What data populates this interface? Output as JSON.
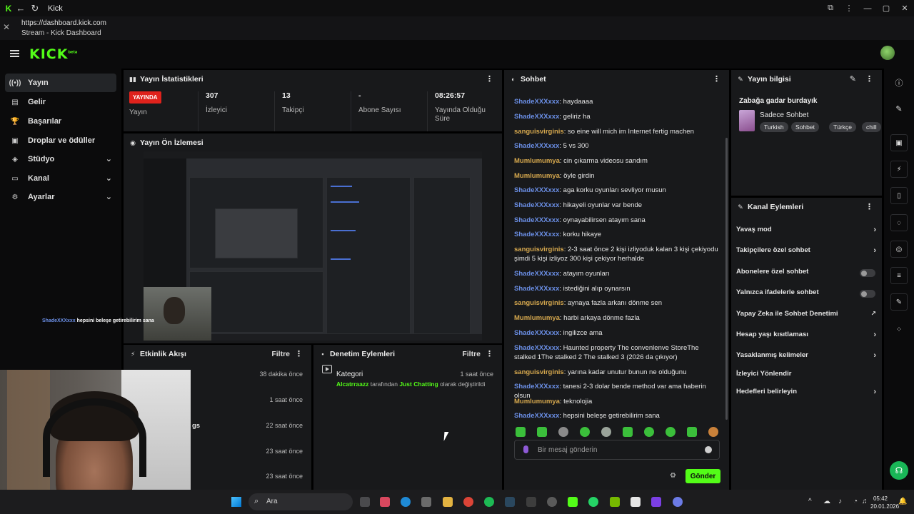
{
  "browser": {
    "tab_title": "Kick",
    "url": "https://dashboard.kick.com",
    "page_title": "Stream - Kick Dashboard"
  },
  "header": {
    "logo": "KICK",
    "logo_badge": "beta"
  },
  "sidebar": {
    "items": [
      {
        "label": "Yayın",
        "icon": "broadcast-icon"
      },
      {
        "label": "Gelir",
        "icon": "wallet-icon"
      },
      {
        "label": "Başarılar",
        "icon": "trophy-icon"
      },
      {
        "label": "Droplar ve ödüller",
        "icon": "gift-icon"
      },
      {
        "label": "Stüdyo",
        "icon": "studio-icon"
      },
      {
        "label": "Kanal",
        "icon": "tv-icon"
      },
      {
        "label": "Ayarlar",
        "icon": "gear-icon"
      }
    ]
  },
  "stats": {
    "title": "Yayın İstatistikleri",
    "live_badge": "YAYINDA",
    "status_label": "Yayın",
    "viewers_value": "307",
    "viewers_label": "İzleyici",
    "followers_value": "13",
    "followers_label": "Takipçi",
    "subs_value": "-",
    "subs_label": "Abone Sayısı",
    "uptime_value": "08:26:57",
    "uptime_label": "Yayında Olduğu Süre"
  },
  "preview": {
    "title": "Yayın Ön İzlemesi",
    "overlay_user": "ShadeXXXxxx",
    "overlay_text": "hepsini beleşe getirebilirim sana"
  },
  "activity": {
    "title": "Etkinlik Akışı",
    "filter": "Filtre",
    "items": [
      {
        "text": "",
        "time": "38 dakika önce"
      },
      {
        "text": "",
        "time": "1 saat önce"
      },
      {
        "text": "gs",
        "time": "22 saat önce"
      },
      {
        "text": "",
        "time": "23 saat önce"
      },
      {
        "text": "",
        "time": "23 saat önce"
      }
    ]
  },
  "moderation": {
    "title": "Denetim Eylemleri",
    "filter": "Filtre",
    "item_title": "Kategori",
    "item_time": "1 saat önce",
    "item_user": "Alcatrraazz",
    "item_by": "tarafından",
    "item_cat": "Just Chatting",
    "item_suffix": "olarak değiştirildi"
  },
  "chat": {
    "title": "Sohbet",
    "colors": {
      "ShadeXXXxxx": "#6b8fe6",
      "sanguisvirginis": "#d6a84e",
      "Mumlumumya": "#d6a84e"
    },
    "messages": [
      {
        "user": "ShadeXXXxxx",
        "text": "haydaaaa"
      },
      {
        "user": "ShadeXXXxxx",
        "text": "geliriz ha"
      },
      {
        "user": "sanguisvirginis",
        "text": "so eine will mich im Internet fertig machen"
      },
      {
        "user": "ShadeXXXxxx",
        "text": "5 vs 300"
      },
      {
        "user": "Mumlumumya",
        "text": "cin çıkarma videosu sandım"
      },
      {
        "user": "Mumlumumya",
        "text": "öyle girdin"
      },
      {
        "user": "ShadeXXXxxx",
        "text": "aga korku oyunları sevliyor musun"
      },
      {
        "user": "ShadeXXXxxx",
        "text": "hikayeli oyunlar var bende"
      },
      {
        "user": "ShadeXXXxxx",
        "text": "oynayabilirsen atayım sana"
      },
      {
        "user": "ShadeXXXxxx",
        "text": "korku hikaye"
      },
      {
        "user": "sanguisvirginis",
        "text": "2-3 saat önce 2 kişi izliyoduk kalan 3 kişi çekiyodu şimdi 5 kişi izliyoz 300 kişi çekiyor herhalde"
      },
      {
        "user": "ShadeXXXxxx",
        "text": "atayım oyunları"
      },
      {
        "user": "ShadeXXXxxx",
        "text": "istediğini alıp oynarsın"
      },
      {
        "user": "sanguisvirginis",
        "text": "aynaya fazla arkanı dönme sen"
      },
      {
        "user": "Mumlumumya",
        "text": "harbi arkaya dönme fazla"
      },
      {
        "user": "ShadeXXXxxx",
        "text": "ingilizce ama"
      },
      {
        "user": "ShadeXXXxxx",
        "text": "Haunted property The convenlenve StoreThe stalked 1The stalked 2 The stalked 3 (2026 da çıkıyor)"
      },
      {
        "user": "sanguisvirginis",
        "text": "yarına kadar unutur bunun ne olduğunu"
      },
      {
        "user": "ShadeXXXxxx",
        "text": "tanesi 2-3 dolar bende method var ama haberin olsun"
      },
      {
        "user": "Mumlumumya",
        "text": "teknolojia"
      },
      {
        "user": "ShadeXXXxxx",
        "text": "hepsini beleşe getirebilirim sana"
      }
    ],
    "input_placeholder": "Bir mesaj gönderin",
    "send_label": "Gönder"
  },
  "stream_info": {
    "title": "Yayın bilgisi",
    "stream_title": "Zabağa gadar burdayık",
    "category": "Sadece Sohbet",
    "tags": [
      "Turkish",
      "Sohbet",
      "Türkçe",
      "chill"
    ]
  },
  "channel_actions": {
    "title": "Kanal Eylemleri",
    "items": [
      {
        "label": "Yavaş mod",
        "control": "chevron"
      },
      {
        "label": "Takipçilere özel sohbet",
        "control": "chevron"
      },
      {
        "label": "Abonelere özel sohbet",
        "control": "toggle"
      },
      {
        "label": "Yalnızca ifadelerle sohbet",
        "control": "toggle"
      },
      {
        "label": "Yapay Zeka ile Sohbet Denetimi",
        "control": "external"
      },
      {
        "label": "Hesap yaşı kısıtlaması",
        "control": "chevron"
      },
      {
        "label": "Yasaklanmış kelimeler",
        "control": "chevron"
      },
      {
        "label": "İzleyici Yönlendir",
        "control": "none"
      },
      {
        "label": "Hedefleri belirleyin",
        "control": "chevron"
      }
    ]
  },
  "taskbar": {
    "search_placeholder": "Ara",
    "time": "05:42",
    "date": "20.01.2026"
  }
}
